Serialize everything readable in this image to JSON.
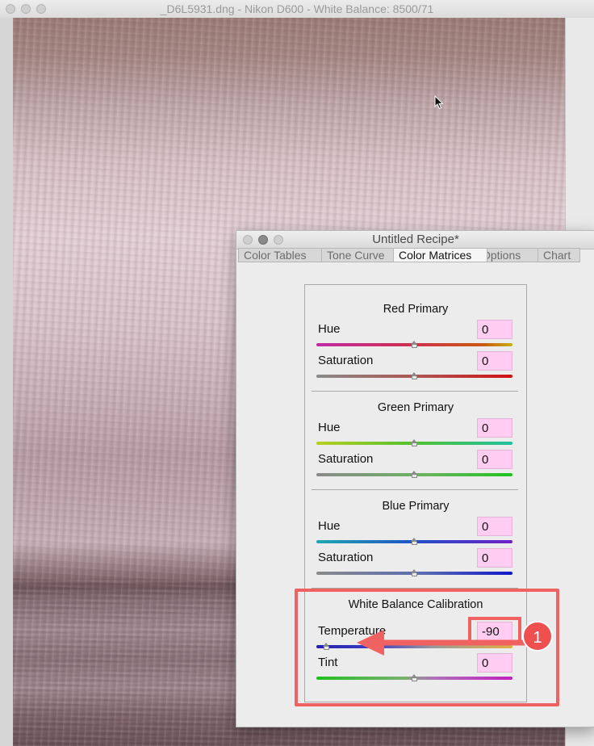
{
  "main_window": {
    "title": "_D6L5931.dng  - Nikon D600 - White Balance: 8500/71"
  },
  "recipe": {
    "title": "Untitled Recipe*",
    "tabs": [
      "Color Tables",
      "Tone Curve",
      "Color Matrices",
      "Options",
      "Chart"
    ],
    "active_tab": "Color Matrices",
    "sections": [
      {
        "title": "Red Primary",
        "rows": [
          {
            "label": "Hue",
            "value": "0",
            "level": 0.5
          },
          {
            "label": "Saturation",
            "value": "0",
            "level": 0.5
          }
        ]
      },
      {
        "title": "Green Primary",
        "rows": [
          {
            "label": "Hue",
            "value": "0",
            "level": 0.5
          },
          {
            "label": "Saturation",
            "value": "0",
            "level": 0.5
          }
        ]
      },
      {
        "title": "Blue Primary",
        "rows": [
          {
            "label": "Hue",
            "value": "0",
            "level": 0.5
          },
          {
            "label": "Saturation",
            "value": "0",
            "level": 0.5
          }
        ]
      },
      {
        "title": "White Balance Calibration",
        "rows": [
          {
            "label": "Temperature",
            "value": "-90",
            "level": 0.05
          },
          {
            "label": "Tint",
            "value": "0",
            "level": 0.5
          }
        ]
      }
    ]
  },
  "annotation": {
    "badge": "1",
    "color": "#f06262"
  },
  "colors": {
    "value_box": "#ffccf2",
    "annotation": "#f06262"
  }
}
